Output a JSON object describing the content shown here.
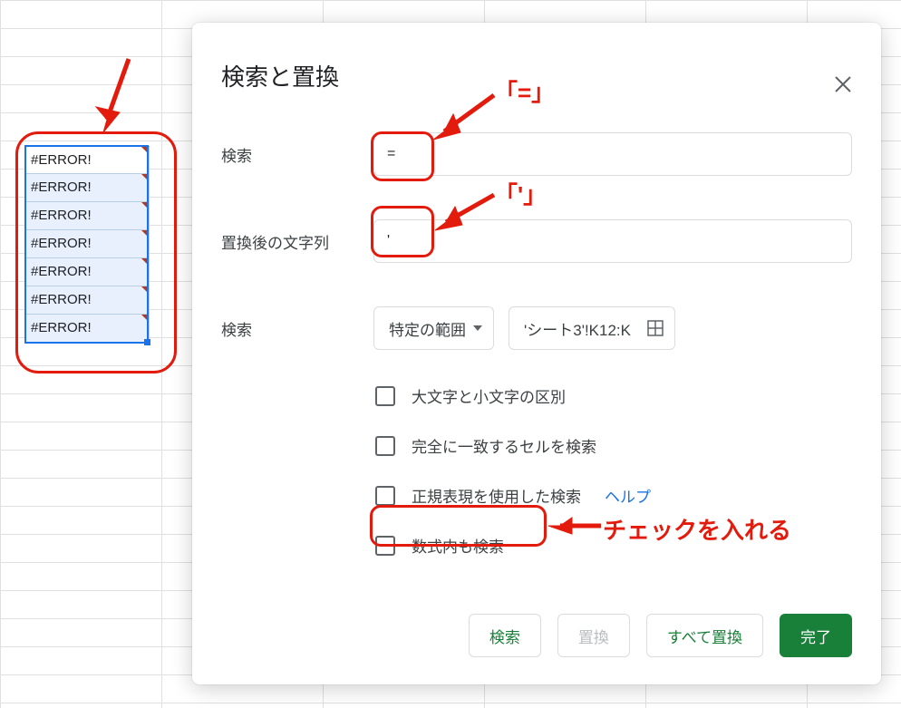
{
  "cells": [
    "#ERROR!",
    "#ERROR!",
    "#ERROR!",
    "#ERROR!",
    "#ERROR!",
    "#ERROR!",
    "#ERROR!"
  ],
  "dialog": {
    "title": "検索と置換",
    "search_label": "検索",
    "search_value": "=",
    "replace_label": "置換後の文字列",
    "replace_value": "'",
    "scope_label": "検索",
    "scope_dropdown": "特定の範囲",
    "range_value": "'シート3'!K12:K",
    "checks": {
      "case": "大文字と小文字の区別",
      "entire": "完全に一致するセルを検索",
      "regex": "正規表現を使用した検索",
      "regex_help": "ヘルプ",
      "formula": "数式内も検索"
    },
    "buttons": {
      "find": "検索",
      "replace": "置換",
      "replace_all": "すべて置換",
      "done": "完了"
    }
  },
  "annotations": {
    "equals": "「=」",
    "apostrophe": "「'」",
    "check_hint": "チェックを入れる"
  }
}
